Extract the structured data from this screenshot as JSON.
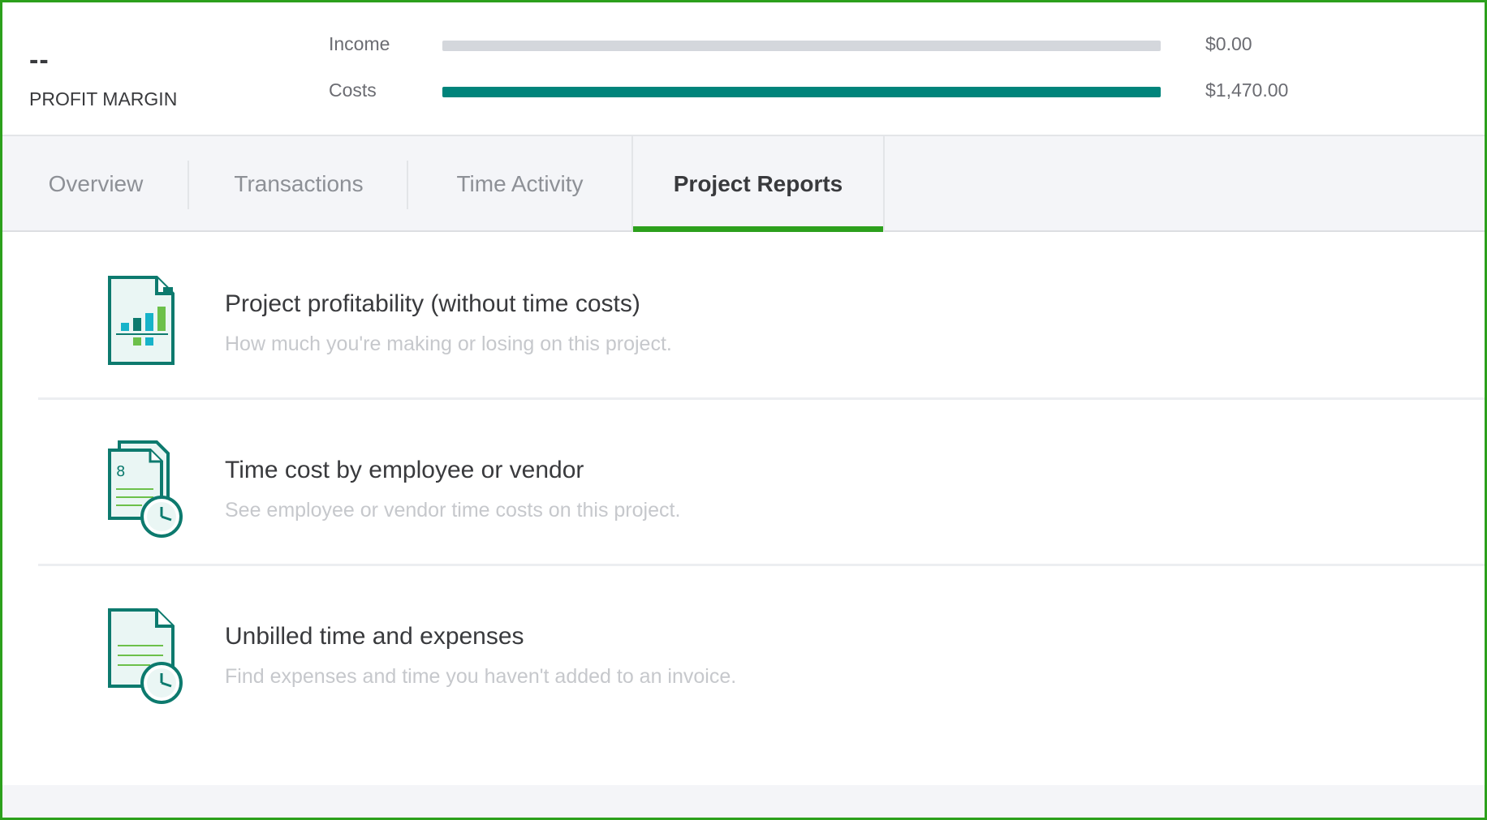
{
  "summary": {
    "profit_margin_value": "--",
    "profit_margin_label": "PROFIT MARGIN",
    "income": {
      "label": "Income",
      "amount": "$0.00",
      "fill_fraction": 0.0
    },
    "costs": {
      "label": "Costs",
      "amount": "$1,470.00",
      "fill_fraction": 1.0
    }
  },
  "tabs": [
    {
      "label": "Overview",
      "active": false
    },
    {
      "label": "Transactions",
      "active": false
    },
    {
      "label": "Time Activity",
      "active": false
    },
    {
      "label": "Project Reports",
      "active": true
    }
  ],
  "reports": [
    {
      "title": "Project profitability (without time costs)",
      "description": "How much you're making or losing on this project.",
      "icon": "bar-chart-document-icon"
    },
    {
      "title": "Time cost by employee or vendor",
      "description": "See employee or vendor time costs on this project.",
      "icon": "timesheet-clock-icon"
    },
    {
      "title": "Unbilled time and expenses",
      "description": "Find expenses and time you haven't added to an invoice.",
      "icon": "document-clock-icon"
    }
  ],
  "colors": {
    "accent_green": "#2ca01c",
    "bar_teal": "#00847b",
    "bar_track": "#d4d7dc",
    "icon_teal": "#0d7a6e",
    "icon_green": "#6cc04a",
    "icon_cyan": "#17b3c9"
  }
}
